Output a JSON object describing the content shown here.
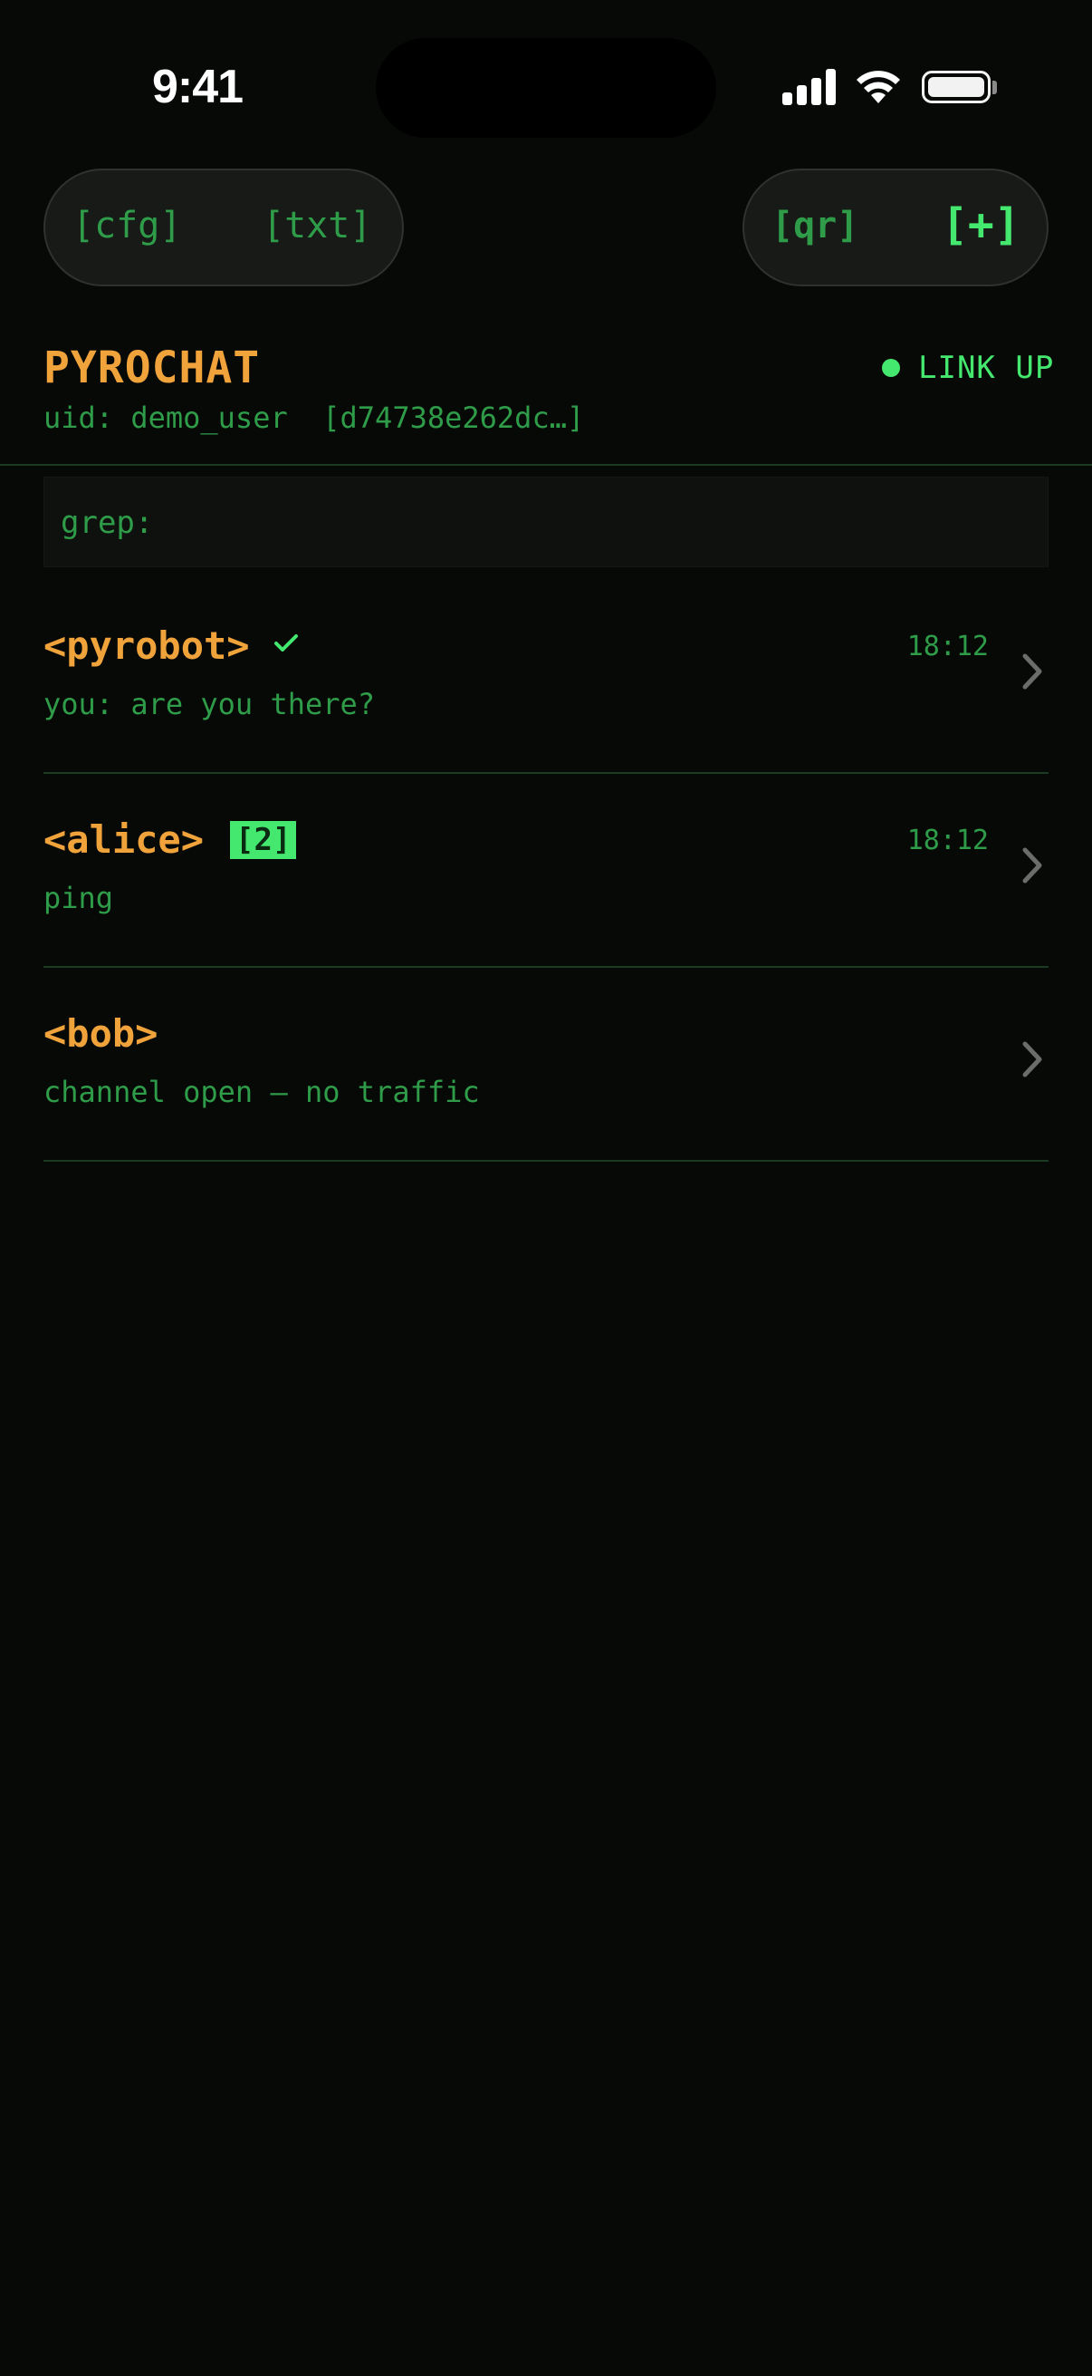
{
  "status_bar": {
    "time": "9:41",
    "icons": [
      "signal-icon",
      "wifi-icon",
      "battery-icon"
    ]
  },
  "toolbar": {
    "cfg_label": "[cfg]",
    "txt_label": "[txt]",
    "qr_label": "[qr]",
    "add_label": "[+]"
  },
  "header": {
    "title": "PYROCHAT",
    "uid_label": "uid: demo_user",
    "uid_hash": "[d74738e262dc…]",
    "status_text": "LINK UP"
  },
  "search": {
    "prompt": "grep:"
  },
  "conversations": [
    {
      "name": "<pyrobot>",
      "verified": true,
      "unread": "",
      "preview": "you: are you there?",
      "time": "18:12"
    },
    {
      "name": "<alice>",
      "verified": false,
      "unread": "[2]",
      "preview": "ping",
      "time": "18:12"
    },
    {
      "name": "<bob>",
      "verified": false,
      "unread": "",
      "preview": "channel open — no traffic",
      "time": ""
    }
  ],
  "colors": {
    "background": "#070907",
    "accent_green": "#44e86e",
    "text_green": "#2e9c48",
    "name_orange": "#f0a33a"
  }
}
